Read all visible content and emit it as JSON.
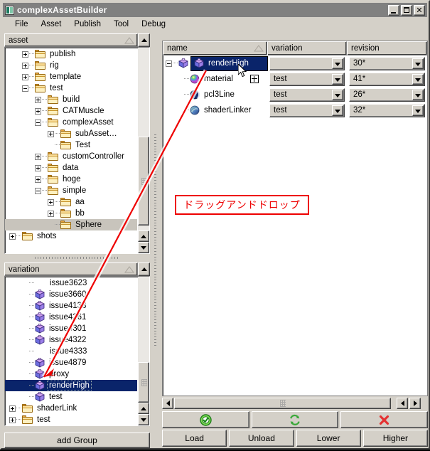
{
  "window": {
    "title": "complexAssetBuilder",
    "icon": "app-icon",
    "buttons": {
      "minimize": "_",
      "maximize": "□",
      "close": "×"
    }
  },
  "menu": {
    "items": [
      "File",
      "Asset",
      "Publish",
      "Tool",
      "Debug"
    ]
  },
  "asset_panel": {
    "header": "asset",
    "items": [
      {
        "label": "publish",
        "depth": 1,
        "toggle": "plus",
        "icon": "folder-icon"
      },
      {
        "label": "rig",
        "depth": 1,
        "toggle": "plus",
        "icon": "folder-icon"
      },
      {
        "label": "template",
        "depth": 1,
        "toggle": "plus",
        "icon": "folder-icon"
      },
      {
        "label": "test",
        "depth": 1,
        "toggle": "minus",
        "icon": "folder-icon"
      },
      {
        "label": "build",
        "depth": 2,
        "toggle": "plus",
        "icon": "folder-icon"
      },
      {
        "label": "CATMuscle",
        "depth": 2,
        "toggle": "plus",
        "icon": "folder-icon"
      },
      {
        "label": "complexAsset",
        "depth": 2,
        "toggle": "minus",
        "icon": "folder-icon"
      },
      {
        "label": "subAsset…",
        "depth": 3,
        "toggle": "plus",
        "icon": "folder-icon"
      },
      {
        "label": "Test",
        "depth": 3,
        "toggle": "none",
        "icon": "folder-icon"
      },
      {
        "label": "customController",
        "depth": 2,
        "toggle": "plus",
        "icon": "folder-icon"
      },
      {
        "label": "data",
        "depth": 2,
        "toggle": "plus",
        "icon": "folder-icon"
      },
      {
        "label": "hoge",
        "depth": 2,
        "toggle": "plus",
        "icon": "folder-icon"
      },
      {
        "label": "simple",
        "depth": 2,
        "toggle": "minus",
        "icon": "folder-icon"
      },
      {
        "label": "aa",
        "depth": 3,
        "toggle": "plus",
        "icon": "folder-icon"
      },
      {
        "label": "bb",
        "depth": 3,
        "toggle": "plus",
        "icon": "folder-icon"
      },
      {
        "label": "Sphere",
        "depth": 3,
        "toggle": "none",
        "icon": "folder-icon",
        "state": "highlighted"
      },
      {
        "label": "shots",
        "depth": 0,
        "toggle": "plus",
        "icon": "folder-icon"
      }
    ]
  },
  "variation_panel": {
    "header": "variation",
    "items": [
      {
        "label": "issue3623",
        "depth": 1,
        "toggle": "none",
        "icon": "none"
      },
      {
        "label": "issue3660",
        "depth": 1,
        "toggle": "none",
        "icon": "cube-icon"
      },
      {
        "label": "issue4138",
        "depth": 1,
        "toggle": "none",
        "icon": "cube-icon"
      },
      {
        "label": "issue4261",
        "depth": 1,
        "toggle": "none",
        "icon": "cube-icon"
      },
      {
        "label": "issue4301",
        "depth": 1,
        "toggle": "none",
        "icon": "cube-icon"
      },
      {
        "label": "issue4322",
        "depth": 1,
        "toggle": "none",
        "icon": "cube-icon"
      },
      {
        "label": "issue4333",
        "depth": 1,
        "toggle": "none",
        "icon": "none"
      },
      {
        "label": "issue4879",
        "depth": 1,
        "toggle": "none",
        "icon": "cube-icon"
      },
      {
        "label": "proxy",
        "depth": 1,
        "toggle": "none",
        "icon": "cube-icon"
      },
      {
        "label": "renderHigh",
        "depth": 1,
        "toggle": "none",
        "icon": "cube-icon",
        "state": "selected"
      },
      {
        "label": "test",
        "depth": 1,
        "toggle": "none",
        "icon": "cube-icon"
      },
      {
        "label": "shaderLink",
        "depth": 0,
        "toggle": "plus",
        "icon": "folder-icon"
      },
      {
        "label": "test",
        "depth": 0,
        "toggle": "plus",
        "icon": "folder-icon"
      }
    ],
    "add_group_button": "add Group"
  },
  "table": {
    "columns": [
      "name",
      "variation",
      "revision"
    ],
    "rows": [
      {
        "name": "renderHigh",
        "depth": 0,
        "toggle": "minus",
        "icon": "cube-icon",
        "variation": "",
        "revision": "30*",
        "selected": true
      },
      {
        "name": "material",
        "depth": 1,
        "toggle": "none",
        "icon": "rainbow-sphere-icon",
        "variation": "test",
        "revision": "41*",
        "selected": false
      },
      {
        "name": "pcl3Line",
        "depth": 1,
        "toggle": "none",
        "icon": "moon-sphere-icon",
        "variation": "test",
        "revision": "26*",
        "selected": false
      },
      {
        "name": "shaderLinker",
        "depth": 1,
        "toggle": "none",
        "icon": "shader-icon",
        "variation": "test",
        "revision": "32*",
        "selected": false
      }
    ],
    "drop_indicator": "plus-box-icon"
  },
  "annotation": {
    "text": "ドラッグアンドドロップ",
    "color": "#ee0000"
  },
  "action_bar": {
    "icon_buttons": [
      {
        "name": "accept-button",
        "icon": "green-check-icon",
        "color": "#2a9a2a"
      },
      {
        "name": "refresh-button",
        "icon": "green-refresh-icon",
        "color": "#3aa33a"
      },
      {
        "name": "delete-button",
        "icon": "red-x-icon",
        "color": "#e03030"
      }
    ],
    "text_buttons": [
      "Load",
      "Unload",
      "Lower",
      "Higher"
    ]
  },
  "cursor": {
    "icon": "arrow-cursor"
  }
}
